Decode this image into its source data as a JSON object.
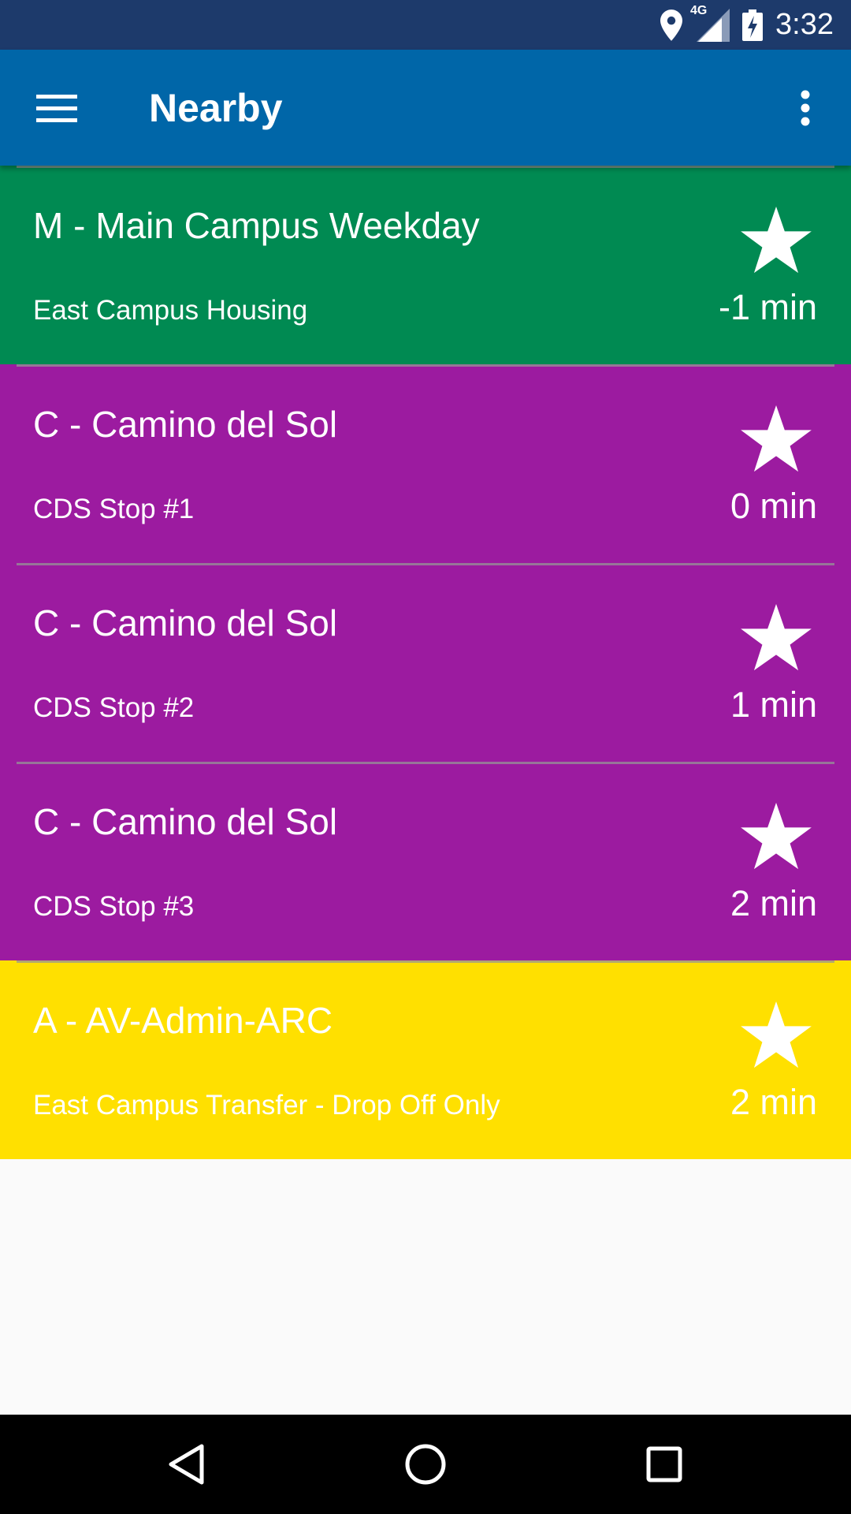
{
  "status_bar": {
    "time": "3:32",
    "network_label": "4G",
    "icons": [
      "location-icon",
      "cell-signal-icon",
      "battery-charging-icon"
    ]
  },
  "app_bar": {
    "title": "Nearby",
    "menu_icon": "hamburger-menu-icon",
    "overflow_icon": "more-vert-icon"
  },
  "colors": {
    "status_bar": "#1d3a6b",
    "app_bar": "#0066a8",
    "route_m": "#008a52",
    "route_c": "#9c1ba0",
    "route_a": "#ffe000",
    "background": "#fafafa",
    "nav_bar": "#000000"
  },
  "arrivals": [
    {
      "route": "M - Main Campus Weekday",
      "stop": "East Campus Housing",
      "eta": "-1 min",
      "color": "#008a52",
      "favorite_icon": "star-icon"
    },
    {
      "route": "C - Camino del Sol",
      "stop": "CDS Stop #1",
      "eta": "0 min",
      "color": "#9c1ba0",
      "favorite_icon": "star-icon"
    },
    {
      "route": "C - Camino del Sol",
      "stop": "CDS Stop #2",
      "eta": "1 min",
      "color": "#9c1ba0",
      "favorite_icon": "star-icon"
    },
    {
      "route": "C - Camino del Sol",
      "stop": "CDS Stop #3",
      "eta": "2 min",
      "color": "#9c1ba0",
      "favorite_icon": "star-icon"
    },
    {
      "route": "A - AV-Admin-ARC",
      "stop": "East Campus Transfer - Drop Off Only",
      "eta": "2 min",
      "color": "#ffe000",
      "favorite_icon": "star-icon"
    }
  ],
  "nav_bar": {
    "buttons": [
      "back-icon",
      "home-icon",
      "recents-icon"
    ]
  }
}
